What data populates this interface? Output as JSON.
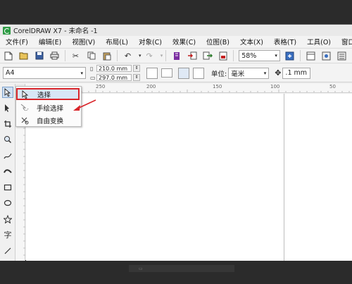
{
  "window": {
    "title": "CorelDRAW X7 - 未命名 -1"
  },
  "menubar": {
    "items": [
      "文件(F)",
      "编辑(E)",
      "视图(V)",
      "布局(L)",
      "对象(C)",
      "效果(C)",
      "位图(B)",
      "文本(X)",
      "表格(T)",
      "工具(O)",
      "窗口(W)"
    ]
  },
  "toolbar": {
    "icons": [
      "new-icon",
      "open-icon",
      "save-icon",
      "print-icon",
      "cut-icon",
      "copy-icon",
      "paste-icon",
      "undo-icon",
      "redo-icon",
      "import-icon",
      "export-icon",
      "publish-icon"
    ],
    "zoom_value": "58%"
  },
  "property_bar": {
    "page_size": "A4",
    "width": "210.0 mm",
    "height": "297.0 mm",
    "unit_label": "单位:",
    "unit_value": "毫米",
    "nudge_value": ".1 mm"
  },
  "ruler": {
    "labels": [
      "250",
      "200",
      "150",
      "100",
      "50"
    ]
  },
  "flyout": {
    "items": [
      "选择",
      "手绘选择",
      "自由变换"
    ]
  },
  "colors": {
    "accent_red": "#d9252a",
    "selection_blue": "#d8e6f6",
    "canvas": "#ffffff"
  }
}
